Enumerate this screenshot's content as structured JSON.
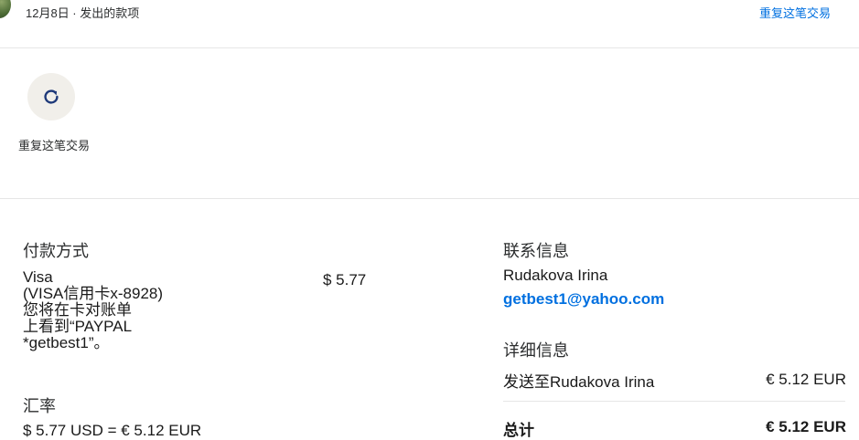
{
  "header": {
    "date_line": "12月8日 · 发出的款项",
    "repeat_link": "重复这笔交易"
  },
  "actions": {
    "repeat_label": "重复这笔交易",
    "repeat_icon": "refresh-icon"
  },
  "payment": {
    "heading": "付款方式",
    "card_lines": [
      "Visa",
      "(VISA信用卡x-8928)",
      "您将在卡对账单",
      "上看到“PAYPAL",
      "*getbest1”。"
    ],
    "amount": "$ 5.77"
  },
  "exchange": {
    "heading": "汇率",
    "value": "$ 5.77 USD = € 5.12 EUR"
  },
  "contact": {
    "heading": "联系信息",
    "name": "Rudakova Irina",
    "email": "getbest1@yahoo.com"
  },
  "details": {
    "heading": "详细信息",
    "sent_to_label": "发送至Rudakova Irina",
    "sent_to_amount": "€ 5.12 EUR",
    "total_label": "总计",
    "total_amount": "€ 5.12 EUR"
  },
  "colors": {
    "link": "#0070e0",
    "icon": "#1f3a7a",
    "circle_bg": "#f1efea",
    "divider": "#e6e6e6"
  }
}
